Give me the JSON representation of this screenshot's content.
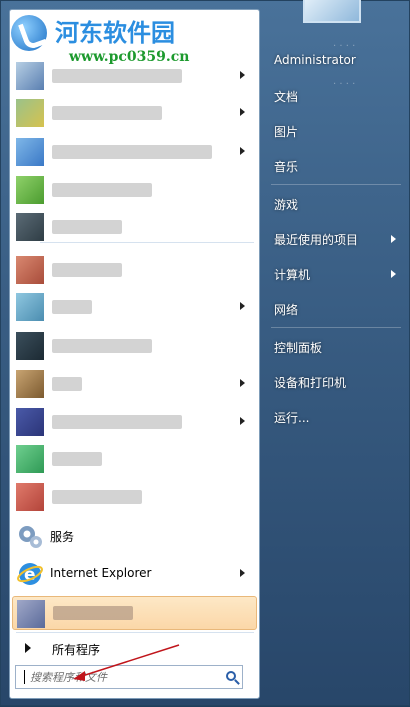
{
  "watermark": {
    "title": "河东软件园",
    "url": "www.pc0359.cn"
  },
  "programs": [
    {
      "label": "",
      "has_arrow": true,
      "icon_colors": [
        "#b7cfe4",
        "#5a7fb1"
      ]
    },
    {
      "label": "",
      "has_arrow": true,
      "icon_colors": [
        "#9ac28a",
        "#d6c24e"
      ]
    },
    {
      "label": "",
      "has_arrow": true,
      "icon_colors": [
        "#7fb7e8",
        "#3a78c6"
      ]
    },
    {
      "label": "",
      "has_arrow": false,
      "icon_colors": [
        "#8fd16a",
        "#4b9c2f"
      ]
    },
    {
      "label": "",
      "has_arrow": false,
      "icon_colors": [
        "#5b6b76",
        "#2f3d45"
      ]
    },
    {
      "label": "",
      "has_arrow": false,
      "icon_colors": [
        "#d98870",
        "#a84c3a"
      ]
    },
    {
      "label": "",
      "has_arrow": true,
      "icon_colors": [
        "#8fc7e0",
        "#4b8db0"
      ]
    },
    {
      "label": "",
      "has_arrow": false,
      "icon_colors": [
        "#3b4f5c",
        "#1c2a33"
      ]
    },
    {
      "label": "",
      "has_arrow": true,
      "icon_colors": [
        "#c8a472",
        "#7c5a2f"
      ]
    },
    {
      "label": "",
      "has_arrow": true,
      "icon_colors": [
        "#4a5aa8",
        "#2b3478"
      ]
    },
    {
      "label": "",
      "has_arrow": false,
      "icon_colors": [
        "#6fcf8f",
        "#2f9a55"
      ]
    },
    {
      "label": "",
      "has_arrow": false,
      "icon_colors": [
        "#e07a6b",
        "#b3443a"
      ]
    }
  ],
  "services": {
    "label": "服务",
    "icon": "gear-icon"
  },
  "ie": {
    "label": "Internet Explorer",
    "icon": "internet-explorer-icon"
  },
  "highlighted_item": {
    "label": ""
  },
  "all_programs": {
    "label": "所有程序"
  },
  "search": {
    "placeholder": "搜索程序和文件"
  },
  "right_pane": {
    "items": [
      {
        "label": "Administrator",
        "has_arrow": false
      },
      {
        "label": "文档",
        "has_arrow": false
      },
      {
        "label": "图片",
        "has_arrow": false
      },
      {
        "label": "音乐",
        "has_arrow": false
      },
      {
        "label": "游戏",
        "has_arrow": false
      },
      {
        "label": "最近使用的项目",
        "has_arrow": true
      },
      {
        "label": "计算机",
        "has_arrow": true
      },
      {
        "label": "网络",
        "has_arrow": false
      },
      {
        "label": "控制面板",
        "has_arrow": false
      },
      {
        "label": "设备和打印机",
        "has_arrow": false
      },
      {
        "label": "运行...",
        "has_arrow": false
      }
    ]
  },
  "colors": {
    "highlight": "#fbd7a8",
    "annotation_arrow": "#c0151b",
    "right_pane_text": "#ffffff"
  }
}
